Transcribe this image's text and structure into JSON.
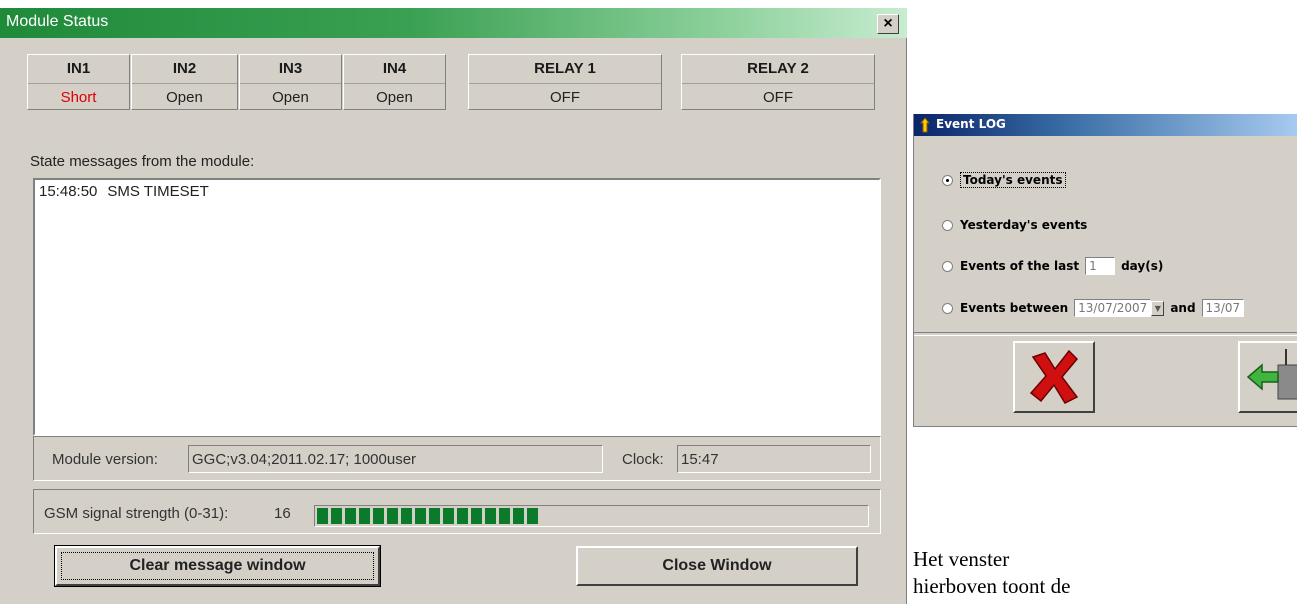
{
  "module_status": {
    "title": "Module Status",
    "close_glyph": "×",
    "io": [
      {
        "label": "IN1",
        "value": "Short",
        "alert": true
      },
      {
        "label": "IN2",
        "value": "Open"
      },
      {
        "label": "IN3",
        "value": "Open"
      },
      {
        "label": "IN4",
        "value": "Open"
      },
      {
        "label": "RELAY 1",
        "value": "OFF"
      },
      {
        "label": "RELAY 2",
        "value": "OFF"
      }
    ],
    "state_label": "State messages from the module:",
    "log": [
      {
        "time": "15:48:50",
        "message": "SMS TIMESET"
      }
    ],
    "version_label": "Module version:",
    "version_value": "GGC;v3.04;2011.02.17; 1000user",
    "clock_label": "Clock:",
    "clock_value": "15:47",
    "signal_label": "GSM signal strength (0-31):",
    "signal_value": "16",
    "signal_level": 16,
    "signal_max": 31,
    "clear_button": "Clear message window",
    "close_button": "Close Window",
    "colors": {
      "titlebar": "#1f8a3a",
      "signal": "#0b7a2a",
      "alert": "#e00000"
    }
  },
  "event_log": {
    "title": "Event LOG",
    "options": {
      "today": "Today's events",
      "yesterday": "Yesterday's events",
      "last_prefix": "Events of the last",
      "last_value": "1",
      "last_suffix": "day(s)",
      "between_prefix": "Events between",
      "date_from": "13/07/2007",
      "and_label": "and",
      "date_to": "13/07"
    },
    "selected": "today",
    "buttons": {
      "cancel_icon": "red-x-icon",
      "ok_icon": "green-arrow-icon"
    }
  },
  "caption": {
    "line1": "Het venster",
    "line2": "hierboven toont de"
  }
}
